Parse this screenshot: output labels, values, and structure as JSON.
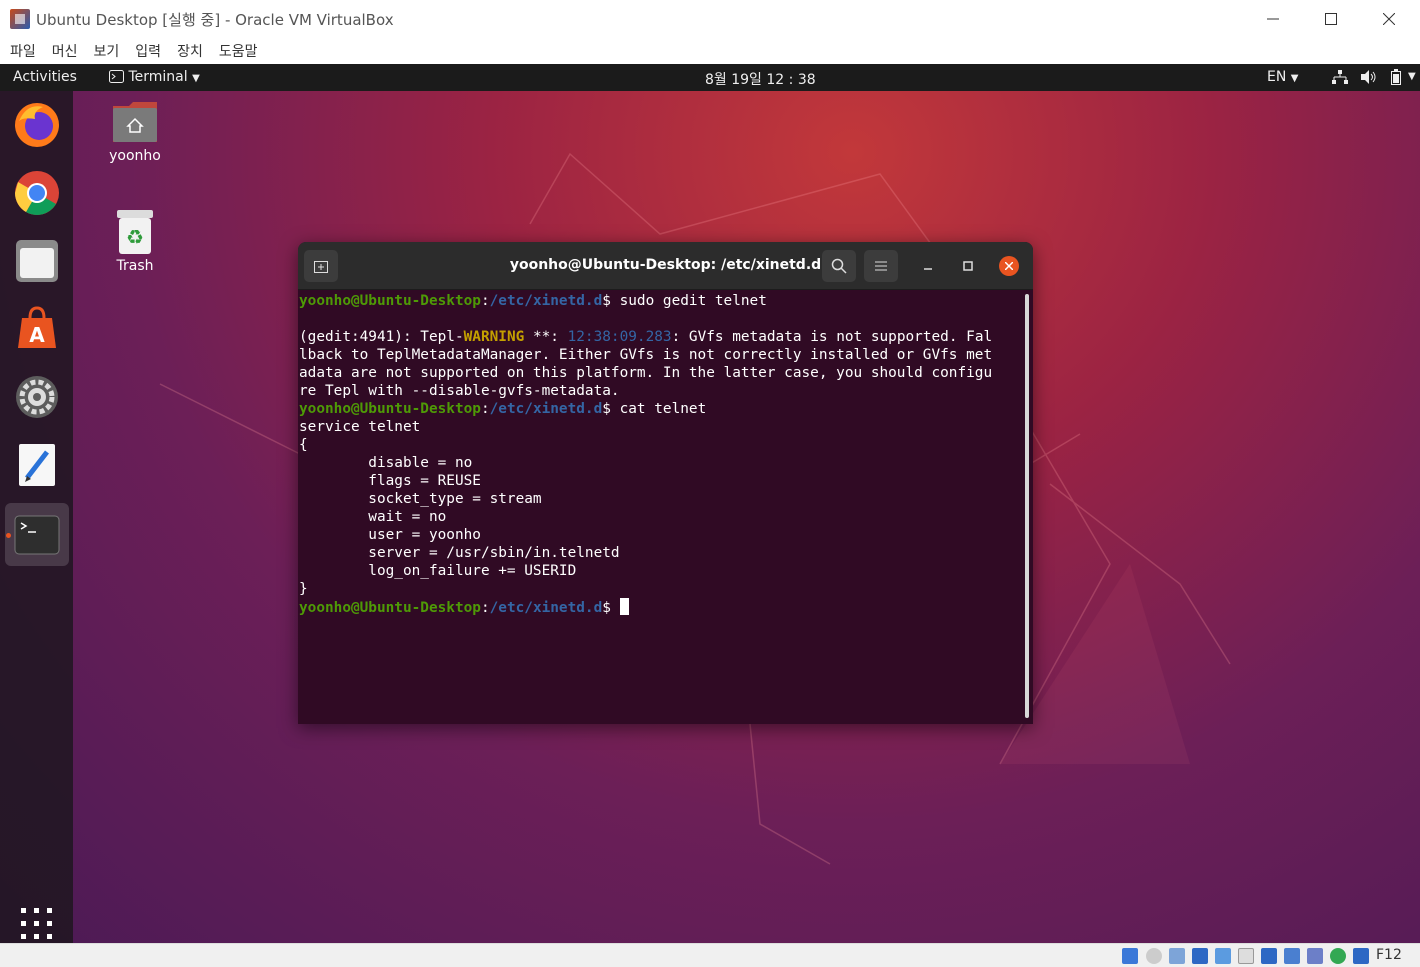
{
  "window": {
    "title": "Ubuntu Desktop [실행 중] - Oracle VM VirtualBox",
    "menu": [
      "파일",
      "머신",
      "보기",
      "입력",
      "장치",
      "도움말"
    ]
  },
  "topbar": {
    "activities": "Activities",
    "app_menu": "Terminal",
    "clock": "8월 19일  12 : 38",
    "language": "EN"
  },
  "dock": {
    "items": [
      "firefox",
      "chrome",
      "files",
      "ubuntu-software",
      "settings",
      "text-editor",
      "terminal",
      "show-applications"
    ]
  },
  "desktop": {
    "home_label": "yoonho",
    "trash_label": "Trash"
  },
  "terminal": {
    "title": "yoonho@Ubuntu-Desktop: /etc/xinetd.d",
    "prompt_user": "yoonho@Ubuntu-Desktop",
    "prompt_path": "/etc/xinetd.d",
    "cmd1": "sudo gedit telnet",
    "warn_prefix": "(gedit:4941): Tepl-",
    "warn_word": "WARNING",
    "warn_stars": " **: ",
    "warn_time": "12:38:09.283",
    "warn_line1_tail": ": GVfs metadata is not supported. Fal",
    "warn_line2": "lback to TeplMetadataManager. Either GVfs is not correctly installed or GVfs met",
    "warn_line3": "adata are not supported on this platform. In the latter case, you should configu",
    "warn_line4": "re Tepl with --disable-gvfs-metadata.",
    "cmd2": "cat telnet",
    "file_lines": [
      "service telnet",
      "{",
      "        disable = no",
      "        flags = REUSE",
      "        socket_type = stream",
      "        wait = no",
      "        user = yoonho",
      "        server = /usr/sbin/in.telnetd",
      "        log_on_failure += USERID",
      "}"
    ]
  },
  "statusbar": {
    "host_key": "F12"
  }
}
